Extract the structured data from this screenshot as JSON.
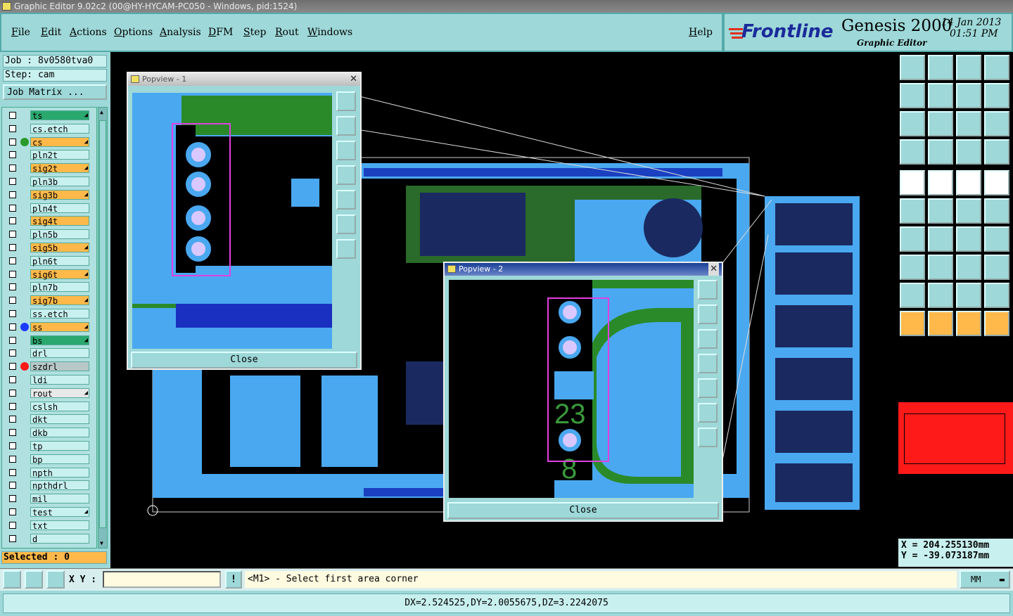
{
  "window": {
    "title": "Graphic Editor 9.02c2 (00@HY-HYCAM-PC050 - Windows, pid:1524)"
  },
  "menu": [
    {
      "label": "File"
    },
    {
      "label": "Edit"
    },
    {
      "label": "Actions"
    },
    {
      "label": "Options"
    },
    {
      "label": "Analysis"
    },
    {
      "label": "DFM"
    },
    {
      "label": "Step"
    },
    {
      "label": "Rout"
    },
    {
      "label": "Windows"
    },
    {
      "label": "Help"
    }
  ],
  "brand": {
    "logo": "Frontline",
    "product": "Genesis 2000",
    "subtitle": "Graphic Editor",
    "date": "14 Jan 2013",
    "time": "01:51 PM"
  },
  "job": {
    "job": "Job : 8v0580tva0",
    "step": "Step: cam",
    "matrix_button": "Job Matrix ..."
  },
  "layers": [
    {
      "name": "ts",
      "color": "#2aa86e",
      "arrow": true
    },
    {
      "name": "cs.etch",
      "color": "#c8f0ef",
      "arrow": false
    },
    {
      "name": "cs",
      "color": "#ffb94a",
      "arrow": true,
      "dot": "#2a9a2a"
    },
    {
      "name": "pln2t",
      "color": "#c8f0ef",
      "arrow": false
    },
    {
      "name": "sig2t",
      "color": "#ffb94a",
      "arrow": true
    },
    {
      "name": "pln3b",
      "color": "#c8f0ef",
      "arrow": false
    },
    {
      "name": "sig3b",
      "color": "#ffb94a",
      "arrow": true
    },
    {
      "name": "pln4t",
      "color": "#c8f0ef",
      "arrow": false
    },
    {
      "name": "sig4t",
      "color": "#ffb94a",
      "arrow": false
    },
    {
      "name": "pln5b",
      "color": "#c8f0ef",
      "arrow": false
    },
    {
      "name": "sig5b",
      "color": "#ffb94a",
      "arrow": true
    },
    {
      "name": "pln6t",
      "color": "#c8f0ef",
      "arrow": false
    },
    {
      "name": "sig6t",
      "color": "#ffb94a",
      "arrow": true
    },
    {
      "name": "pln7b",
      "color": "#c8f0ef",
      "arrow": false
    },
    {
      "name": "sig7b",
      "color": "#ffb94a",
      "arrow": true
    },
    {
      "name": "ss.etch",
      "color": "#c8f0ef",
      "arrow": false
    },
    {
      "name": "ss",
      "color": "#ffb94a",
      "arrow": true,
      "dot": "#1a3aff"
    },
    {
      "name": "bs",
      "color": "#2aa86e",
      "arrow": true
    },
    {
      "name": "drl",
      "color": "#c8f0ef",
      "arrow": false
    },
    {
      "name": "szdrl",
      "color": "#b8c8c8",
      "arrow": false,
      "dot": "#ff1a1a"
    },
    {
      "name": "ldi",
      "color": "#c8f0ef",
      "arrow": false
    },
    {
      "name": "rout",
      "color": "#e8e8e8",
      "arrow": true
    },
    {
      "name": "cslsh",
      "color": "#c8f0ef",
      "arrow": false
    },
    {
      "name": "dkt",
      "color": "#c8f0ef",
      "arrow": false
    },
    {
      "name": "dkb",
      "color": "#c8f0ef",
      "arrow": false
    },
    {
      "name": "tp",
      "color": "#c8f0ef",
      "arrow": false
    },
    {
      "name": "bp",
      "color": "#c8f0ef",
      "arrow": false
    },
    {
      "name": "npth",
      "color": "#c8f0ef",
      "arrow": false
    },
    {
      "name": "npthdrl",
      "color": "#c8f0ef",
      "arrow": false
    },
    {
      "name": "mil",
      "color": "#c8f0ef",
      "arrow": false
    },
    {
      "name": "test",
      "color": "#c8f0ef",
      "arrow": true
    },
    {
      "name": "txt",
      "color": "#c8f0ef",
      "arrow": false
    },
    {
      "name": "d",
      "color": "#c8f0ef",
      "arrow": false
    }
  ],
  "selected": "Selected : 0",
  "popview1": {
    "title": "Popview - 1",
    "close": "Close"
  },
  "popview2": {
    "title": "Popview - 2",
    "close": "Close",
    "text_23": "23",
    "text_8": "8"
  },
  "coords": {
    "x": "X  =  204.255130mm",
    "y": "Y  =  -39.073187mm"
  },
  "toolbar": {
    "xy_label": "X Y :",
    "xy_value": "",
    "prompt": "<M1> - Select first area corner",
    "units": "MM"
  },
  "status": {
    "measure": "DX=2.524525,DY=2.0055675,DZ=3.2242075"
  },
  "tool_grid": {
    "icons": [
      "zoom-home",
      "zoom-in",
      "zoom-home2",
      "zoom-split",
      "pan-left",
      "pan-right",
      "zoom-step",
      "zoom-arrange",
      "zoom-fit",
      "zoom-center",
      "zoom-1to2",
      "help",
      "measure",
      "snap",
      "netlist",
      "netlist-red",
      "feature-select",
      "feature-highlight",
      "ruler",
      "snap-box",
      "link",
      "cross",
      "move",
      "copy",
      "line",
      "line2",
      "rotate",
      "mirror",
      "pad",
      "wire",
      "scale",
      "pads",
      "triangle",
      "triangle2",
      "triangle3",
      "triangle4",
      "pointer",
      "pointer2",
      "pointer3",
      "route"
    ]
  }
}
